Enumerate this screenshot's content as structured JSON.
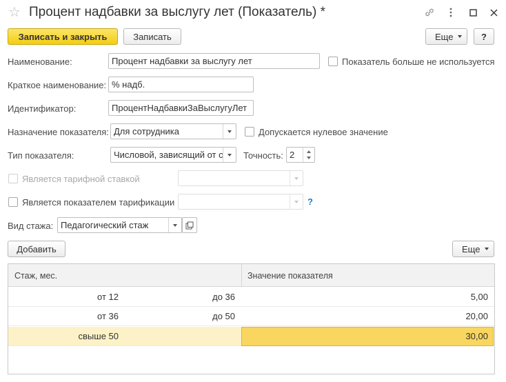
{
  "window": {
    "title": "Процент надбавки за выслугу лет (Показатель) *"
  },
  "toolbar": {
    "save_close": "Записать и закрыть",
    "save": "Записать",
    "more": "Еще",
    "help": "?"
  },
  "form": {
    "name": {
      "label": "Наименование:",
      "value": "Процент надбавки за выслугу лет"
    },
    "unused": {
      "label": "Показатель больше не используется",
      "checked": false
    },
    "short_name": {
      "label": "Краткое наименование:",
      "value": "% надб."
    },
    "identifier": {
      "label": "Идентификатор:",
      "value": "ПроцентНадбавкиЗаВыслугуЛет"
    },
    "purpose": {
      "label": "Назначение показателя:",
      "value": "Для сотрудника"
    },
    "zero_allowed": {
      "label": "Допускается нулевое значение",
      "checked": false
    },
    "type": {
      "label": "Тип показателя:",
      "value": "Числовой, зависящий от с"
    },
    "precision": {
      "label": "Точность:",
      "value": "2"
    },
    "tariff_rate": {
      "label": "Является тарифной ставкой",
      "value": "",
      "checked": false,
      "disabled": true
    },
    "tariff_indicator": {
      "label": "Является показателем тарификации",
      "value": "",
      "checked": false,
      "help": "?"
    },
    "seniority_type": {
      "label": "Вид стажа:",
      "value": "Педагогический стаж"
    }
  },
  "table_toolbar": {
    "add": "Добавить",
    "more": "Еще"
  },
  "table": {
    "columns": [
      "Стаж, мес.",
      "Значение показателя"
    ],
    "rows": [
      {
        "from": "от 12",
        "to": "до 36",
        "value": "5,00",
        "selected": false
      },
      {
        "from": "от 36",
        "to": "до 50",
        "value": "20,00",
        "selected": false
      },
      {
        "from": "свыше 50",
        "to": "",
        "value": "30,00",
        "selected": true
      }
    ]
  }
}
